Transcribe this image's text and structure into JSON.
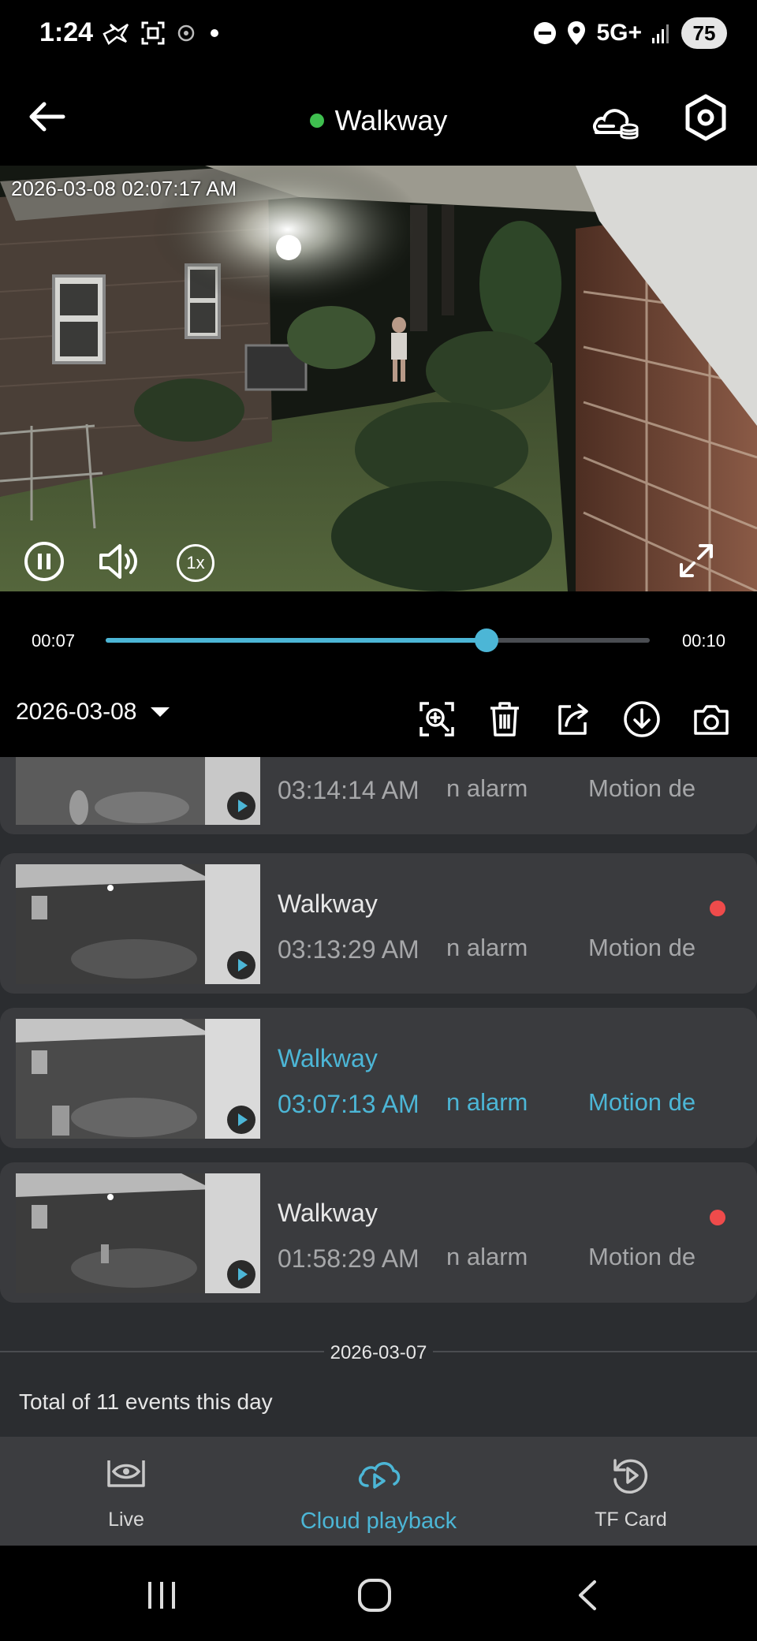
{
  "status_bar": {
    "time": "1:24",
    "network": "5G+",
    "battery": "75"
  },
  "header": {
    "title": "Walkway",
    "online_color": "#3fbf4f"
  },
  "video": {
    "timestamp": "2026-03-08 02:07:17 AM",
    "speed_label": "1x"
  },
  "playback": {
    "current": "00:07",
    "total": "00:10",
    "progress": 0.7,
    "accent": "#4cb6d6"
  },
  "toolbar": {
    "date": "2026-03-08",
    "tools": [
      "zoom-icon",
      "trash-icon",
      "share-icon",
      "download-icon",
      "camera-icon"
    ]
  },
  "events": [
    {
      "name": "",
      "time": "03:14:14 AM",
      "type": "n alarm",
      "motion": "Motion de",
      "active": false,
      "unread": false
    },
    {
      "name": "Walkway",
      "time": "03:13:29 AM",
      "type": "n alarm",
      "motion": "Motion de",
      "active": false,
      "unread": true
    },
    {
      "name": "Walkway",
      "time": "03:07:13 AM",
      "type": "n alarm",
      "motion": "Motion de",
      "active": true,
      "unread": false
    },
    {
      "name": "Walkway",
      "time": "01:58:29 AM",
      "type": "n alarm",
      "motion": "Motion de",
      "active": false,
      "unread": true
    }
  ],
  "day_section": {
    "date": "2026-03-07",
    "total": "Total of 11 events this day"
  },
  "bottom_nav": {
    "live": "Live",
    "cloud": "Cloud playback",
    "tf": "TF Card"
  }
}
